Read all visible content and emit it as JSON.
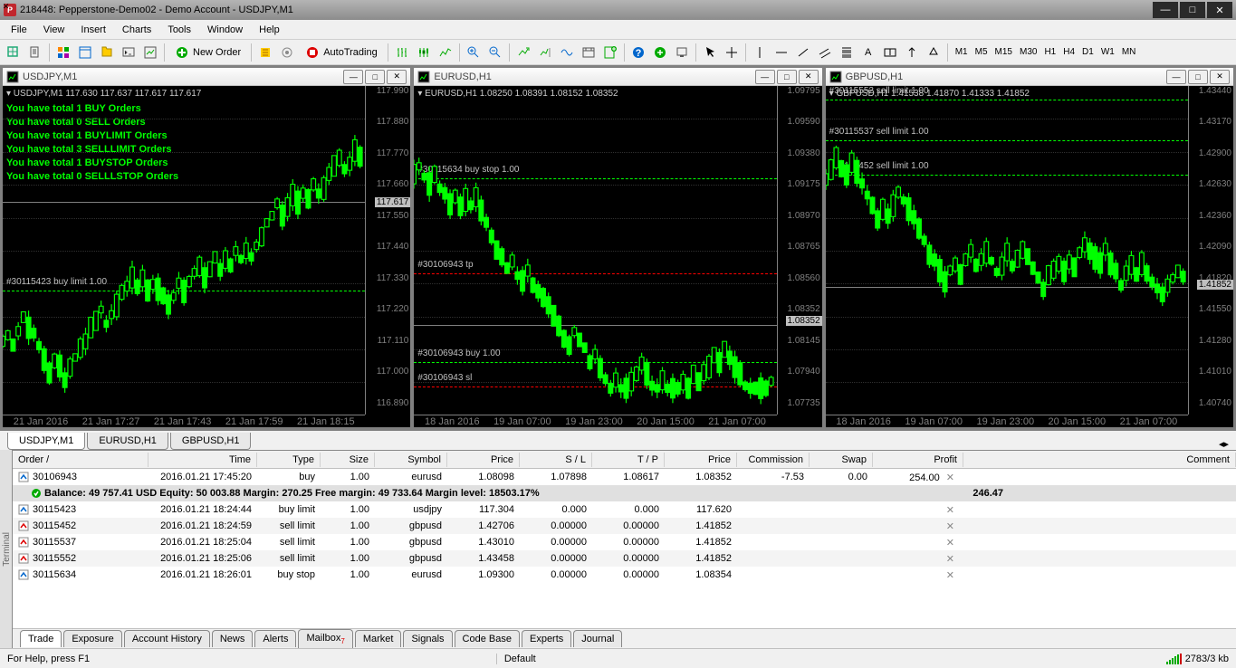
{
  "window": {
    "title": "218448: Pepperstone-Demo02 - Demo Account - USDJPY,M1",
    "app_icon": "P"
  },
  "menu": [
    "File",
    "View",
    "Insert",
    "Charts",
    "Tools",
    "Window",
    "Help"
  ],
  "toolbar": {
    "new_order": "New Order",
    "auto_trading": "AutoTrading",
    "timeframes": [
      "M1",
      "M5",
      "M15",
      "M30",
      "H1",
      "H4",
      "D1",
      "W1",
      "MN"
    ]
  },
  "charts": [
    {
      "title": "USDJPY,M1",
      "header": "USDJPY,M1  117.630 117.637 117.617 117.617",
      "overlay": [
        "You have total 1 BUY Orders",
        "You have total 0 SELL Orders",
        "You have total 1 BUYLIMIT Orders",
        "You have total 3 SELLLIMIT Orders",
        "You have total 1 BUYSTOP Orders",
        "You have total 0 SELLLSTOP Orders"
      ],
      "yticks": [
        "117.990",
        "117.880",
        "117.770",
        "117.660",
        "117.550",
        "117.440",
        "117.330",
        "117.220",
        "117.110",
        "117.000",
        "116.890"
      ],
      "current": "117.617",
      "current_pct": 34,
      "anno": [
        {
          "label": "#30115423 buy limit 1.00",
          "pct": 60,
          "type": "green"
        }
      ],
      "xticks": [
        "21 Jan 2016",
        "21 Jan 17:27",
        "21 Jan 17:43",
        "21 Jan 17:59",
        "21 Jan 18:15"
      ]
    },
    {
      "title": "EURUSD,H1",
      "header": "EURUSD,H1  1.08250 1.08391 1.08152 1.08352",
      "overlay": [],
      "yticks": [
        "1.09795",
        "1.09590",
        "1.09380",
        "1.09175",
        "1.08970",
        "1.08765",
        "1.08560",
        "1.08352",
        "1.08145",
        "1.07940",
        "1.07735"
      ],
      "current": "1.08352",
      "current_pct": 70,
      "anno": [
        {
          "label": "#30115634 buy stop 1.00",
          "pct": 27,
          "type": "green"
        },
        {
          "label": "#30106943 tp",
          "pct": 55,
          "type": "red"
        },
        {
          "label": "#30106943 buy 1.00",
          "pct": 81,
          "type": "green"
        },
        {
          "label": "#30106943 sl",
          "pct": 88,
          "type": "red"
        }
      ],
      "xticks": [
        "18 Jan 2016",
        "19 Jan 07:00",
        "19 Jan 23:00",
        "20 Jan 15:00",
        "21 Jan 07:00"
      ]
    },
    {
      "title": "GBPUSD,H1",
      "header": "GBPUSD,H1  1.41538 1.41870 1.41333 1.41852",
      "overlay": [],
      "yticks": [
        "1.43440",
        "1.43170",
        "1.42900",
        "1.42630",
        "1.42360",
        "1.42090",
        "1.41820",
        "1.41550",
        "1.41280",
        "1.41010",
        "1.40740"
      ],
      "current": "1.41852",
      "current_pct": 59,
      "anno": [
        {
          "label": "#30115552 sell limit 1.00",
          "pct": 4,
          "type": "green"
        },
        {
          "label": "#30115537 sell limit 1.00",
          "pct": 16,
          "type": "green"
        },
        {
          "label": "#30115452 sell limit 1.00",
          "pct": 26,
          "type": "green"
        }
      ],
      "xticks": [
        "18 Jan 2016",
        "19 Jan 07:00",
        "19 Jan 23:00",
        "20 Jan 15:00",
        "21 Jan 07:00"
      ]
    }
  ],
  "doc_tabs": [
    "USDJPY,M1",
    "EURUSD,H1",
    "GBPUSD,H1"
  ],
  "doc_tab_active": 0,
  "terminal": {
    "headers": [
      "Order",
      "Time",
      "Type",
      "Size",
      "Symbol",
      "Price",
      "S / L",
      "T / P",
      "Price",
      "Commission",
      "Swap",
      "Profit",
      "Comment"
    ],
    "rows": [
      {
        "id": "30106943",
        "time": "2016.01.21 17:45:20",
        "type": "buy",
        "size": "1.00",
        "sym": "eurusd",
        "p1": "1.08098",
        "sl": "1.07898",
        "tp": "1.08617",
        "p2": "1.08352",
        "comm": "-7.53",
        "swap": "0.00",
        "profit": "254.00",
        "icon": "buy"
      }
    ],
    "balance_line": "Balance: 49 757.41 USD  Equity: 50 003.88  Margin: 270.25  Free margin: 49 733.64  Margin level: 18503.17%",
    "balance_profit": "246.47",
    "pending": [
      {
        "id": "30115423",
        "time": "2016.01.21 18:24:44",
        "type": "buy limit",
        "size": "1.00",
        "sym": "usdjpy",
        "p1": "117.304",
        "sl": "0.000",
        "tp": "0.000",
        "p2": "117.620",
        "icon": "buylimit"
      },
      {
        "id": "30115452",
        "time": "2016.01.21 18:24:59",
        "type": "sell limit",
        "size": "1.00",
        "sym": "gbpusd",
        "p1": "1.42706",
        "sl": "0.00000",
        "tp": "0.00000",
        "p2": "1.41852",
        "icon": "selllimit"
      },
      {
        "id": "30115537",
        "time": "2016.01.21 18:25:04",
        "type": "sell limit",
        "size": "1.00",
        "sym": "gbpusd",
        "p1": "1.43010",
        "sl": "0.00000",
        "tp": "0.00000",
        "p2": "1.41852",
        "icon": "selllimit"
      },
      {
        "id": "30115552",
        "time": "2016.01.21 18:25:06",
        "type": "sell limit",
        "size": "1.00",
        "sym": "gbpusd",
        "p1": "1.43458",
        "sl": "0.00000",
        "tp": "0.00000",
        "p2": "1.41852",
        "icon": "selllimit"
      },
      {
        "id": "30115634",
        "time": "2016.01.21 18:26:01",
        "type": "buy stop",
        "size": "1.00",
        "sym": "eurusd",
        "p1": "1.09300",
        "sl": "0.00000",
        "tp": "0.00000",
        "p2": "1.08354",
        "icon": "buystop"
      }
    ],
    "tabs": [
      "Trade",
      "Exposure",
      "Account History",
      "News",
      "Alerts",
      "Mailbox",
      "Market",
      "Signals",
      "Code Base",
      "Experts",
      "Journal"
    ],
    "tab_active": 0,
    "sidebar_label": "Terminal"
  },
  "statusbar": {
    "help": "For Help, press F1",
    "profile": "Default",
    "conn": "2783/3 kb"
  }
}
